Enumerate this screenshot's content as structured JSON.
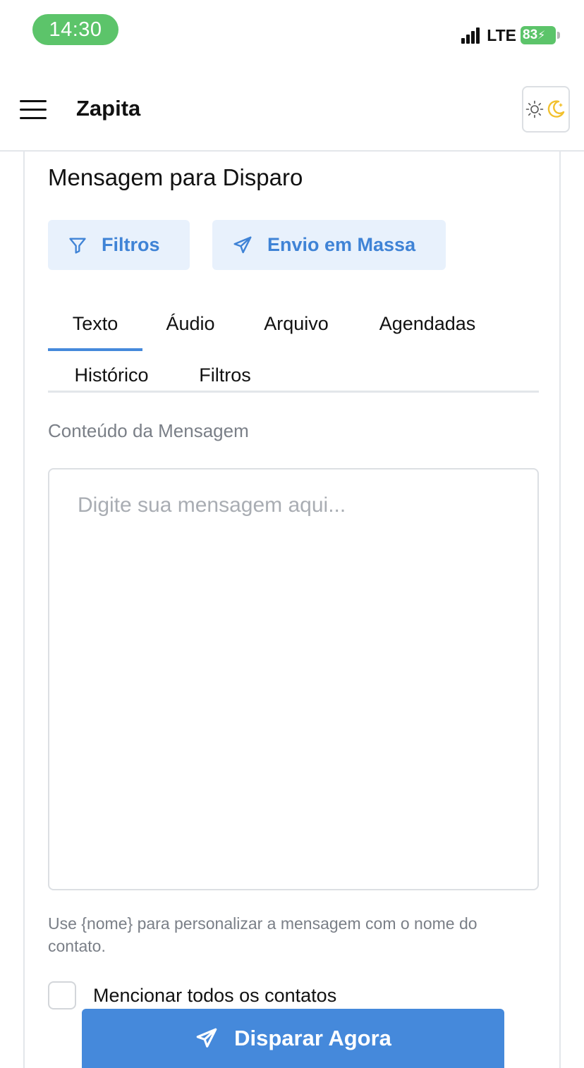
{
  "status_bar": {
    "time": "14:30",
    "network": "LTE",
    "battery": "83"
  },
  "header": {
    "app_title": "Zapita",
    "menu_icon": "hamburger-icon",
    "theme_icons": [
      "sun-icon",
      "moon-icon"
    ]
  },
  "section": {
    "title": "Mensagem para Disparo",
    "buttons": {
      "filters": "Filtros",
      "bulk_send": "Envio em Massa"
    }
  },
  "tabs": [
    {
      "label": "Texto",
      "active": true
    },
    {
      "label": "Áudio",
      "active": false
    },
    {
      "label": "Arquivo",
      "active": false
    },
    {
      "label": "Agendadas",
      "active": false
    },
    {
      "label": "Histórico",
      "active": false
    },
    {
      "label": "Filtros",
      "active": false
    }
  ],
  "form": {
    "message_label": "Conteúdo da Mensagem",
    "message_value": "",
    "message_placeholder": "Digite sua mensagem aqui...",
    "hint": "Use {nome} para personalizar a mensagem com o nome do contato.",
    "mention_all_label": "Mencionar todos os contatos",
    "mention_all_checked": false,
    "submit_label": "Disparar Agora"
  },
  "colors": {
    "accent": "#4589db",
    "accent_light_bg": "#e8f1fc",
    "status_green": "#5cc46a",
    "moon_yellow": "#f2c12e"
  }
}
